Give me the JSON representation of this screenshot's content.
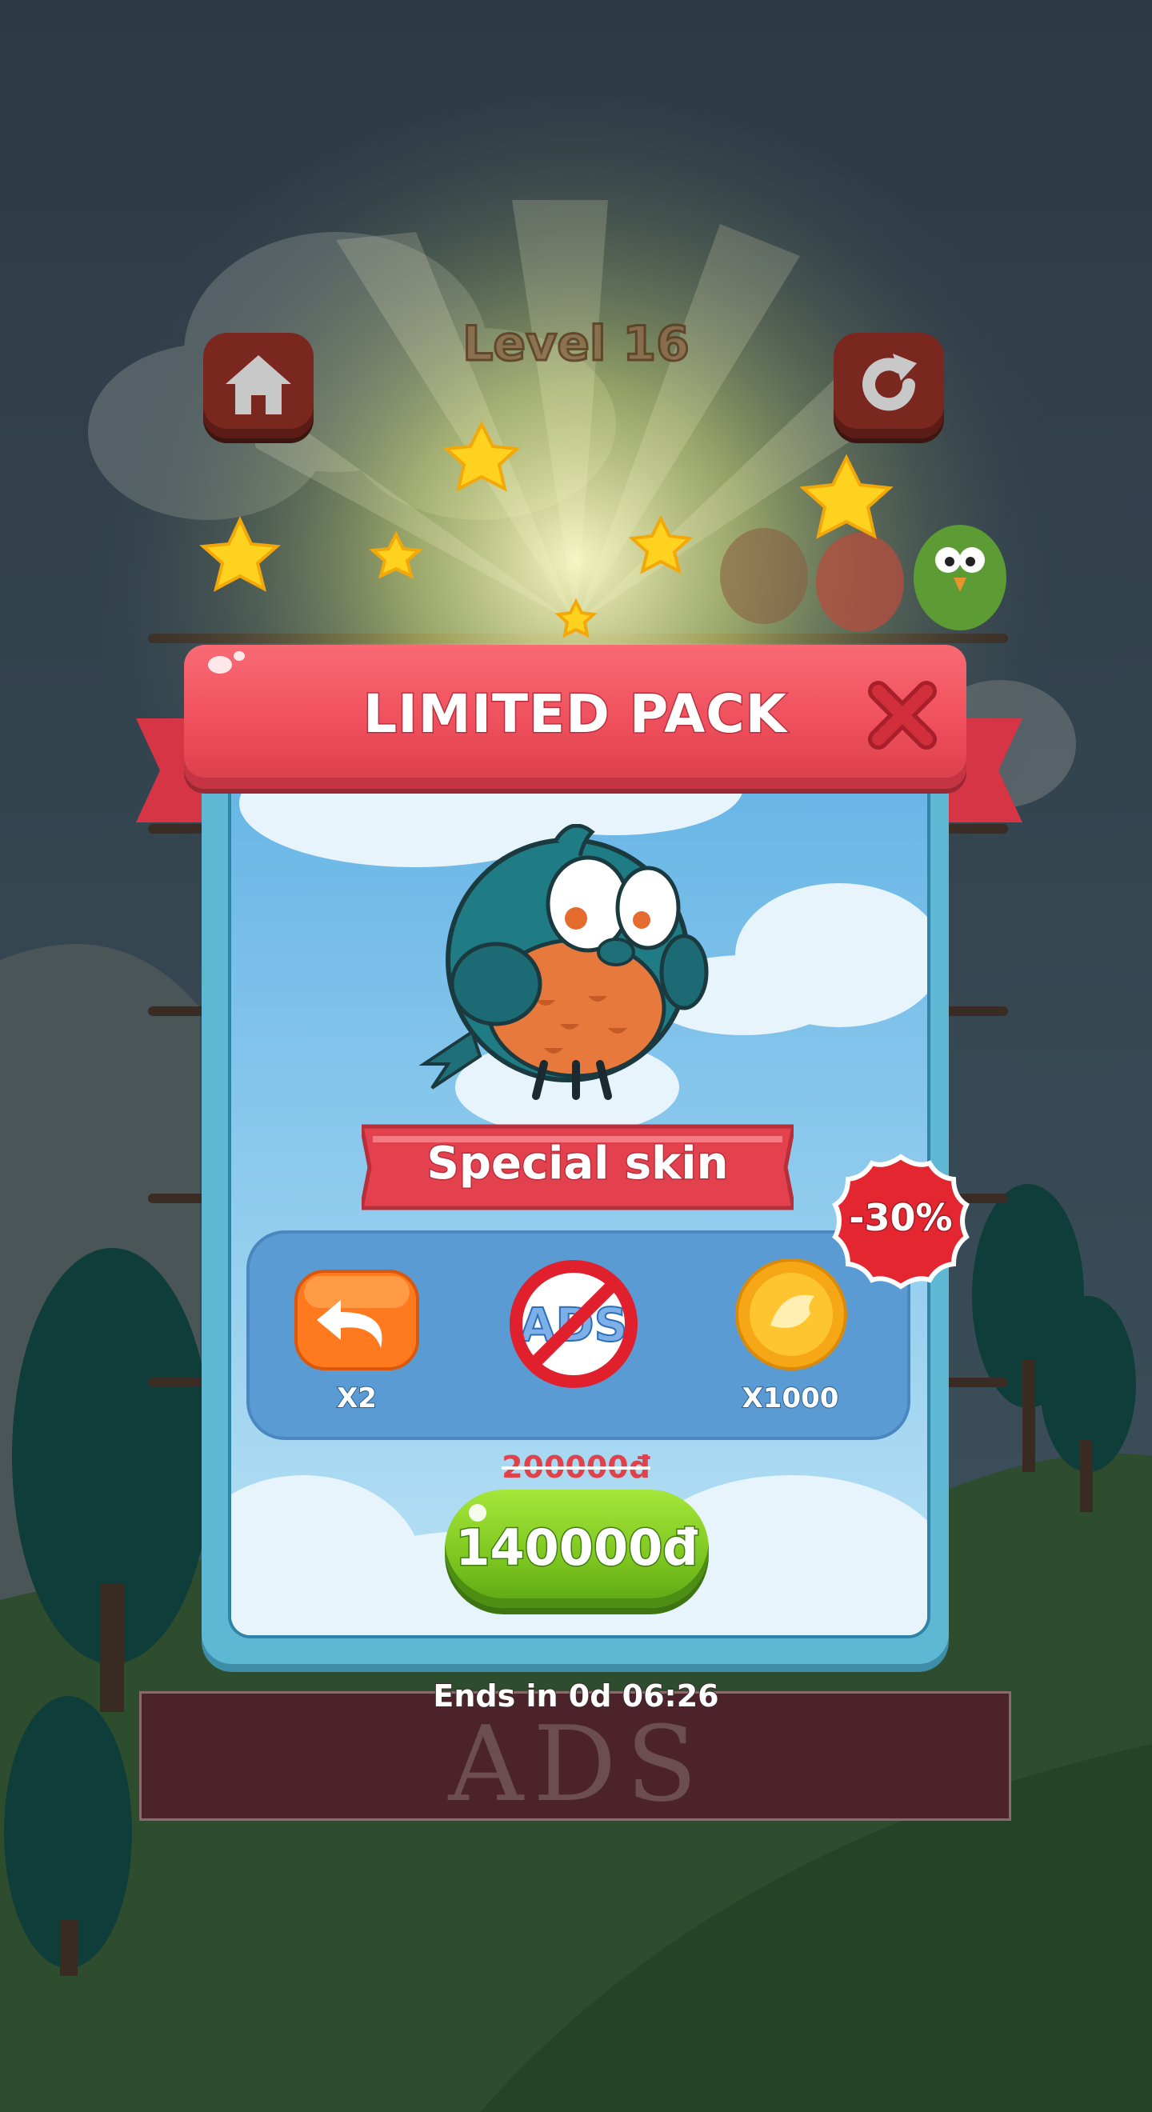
{
  "top_bar": {
    "level_title": "Level 16",
    "home_icon": "home-icon",
    "restart_icon": "restart-icon"
  },
  "popup": {
    "title": "LIMITED PACK",
    "close_icon": "close-icon",
    "item_label": "Special skin",
    "discount": "-30%",
    "rewards": [
      {
        "icon": "undo-icon",
        "label": "X2"
      },
      {
        "icon": "no-ads-icon",
        "label": ""
      },
      {
        "icon": "coin-icon",
        "label": "X1000"
      }
    ],
    "no_ads_text": "ADS",
    "old_price": "200000đ",
    "price": "140000đ"
  },
  "timer": "Ends in 0d 06:26",
  "ad_banner": {
    "text": "ADS"
  },
  "colors": {
    "header_red": "#ef4f5c",
    "buy_green": "#7cc51f",
    "reward_panel_blue": "#5b9bd3",
    "discount_red": "#e3262f"
  }
}
